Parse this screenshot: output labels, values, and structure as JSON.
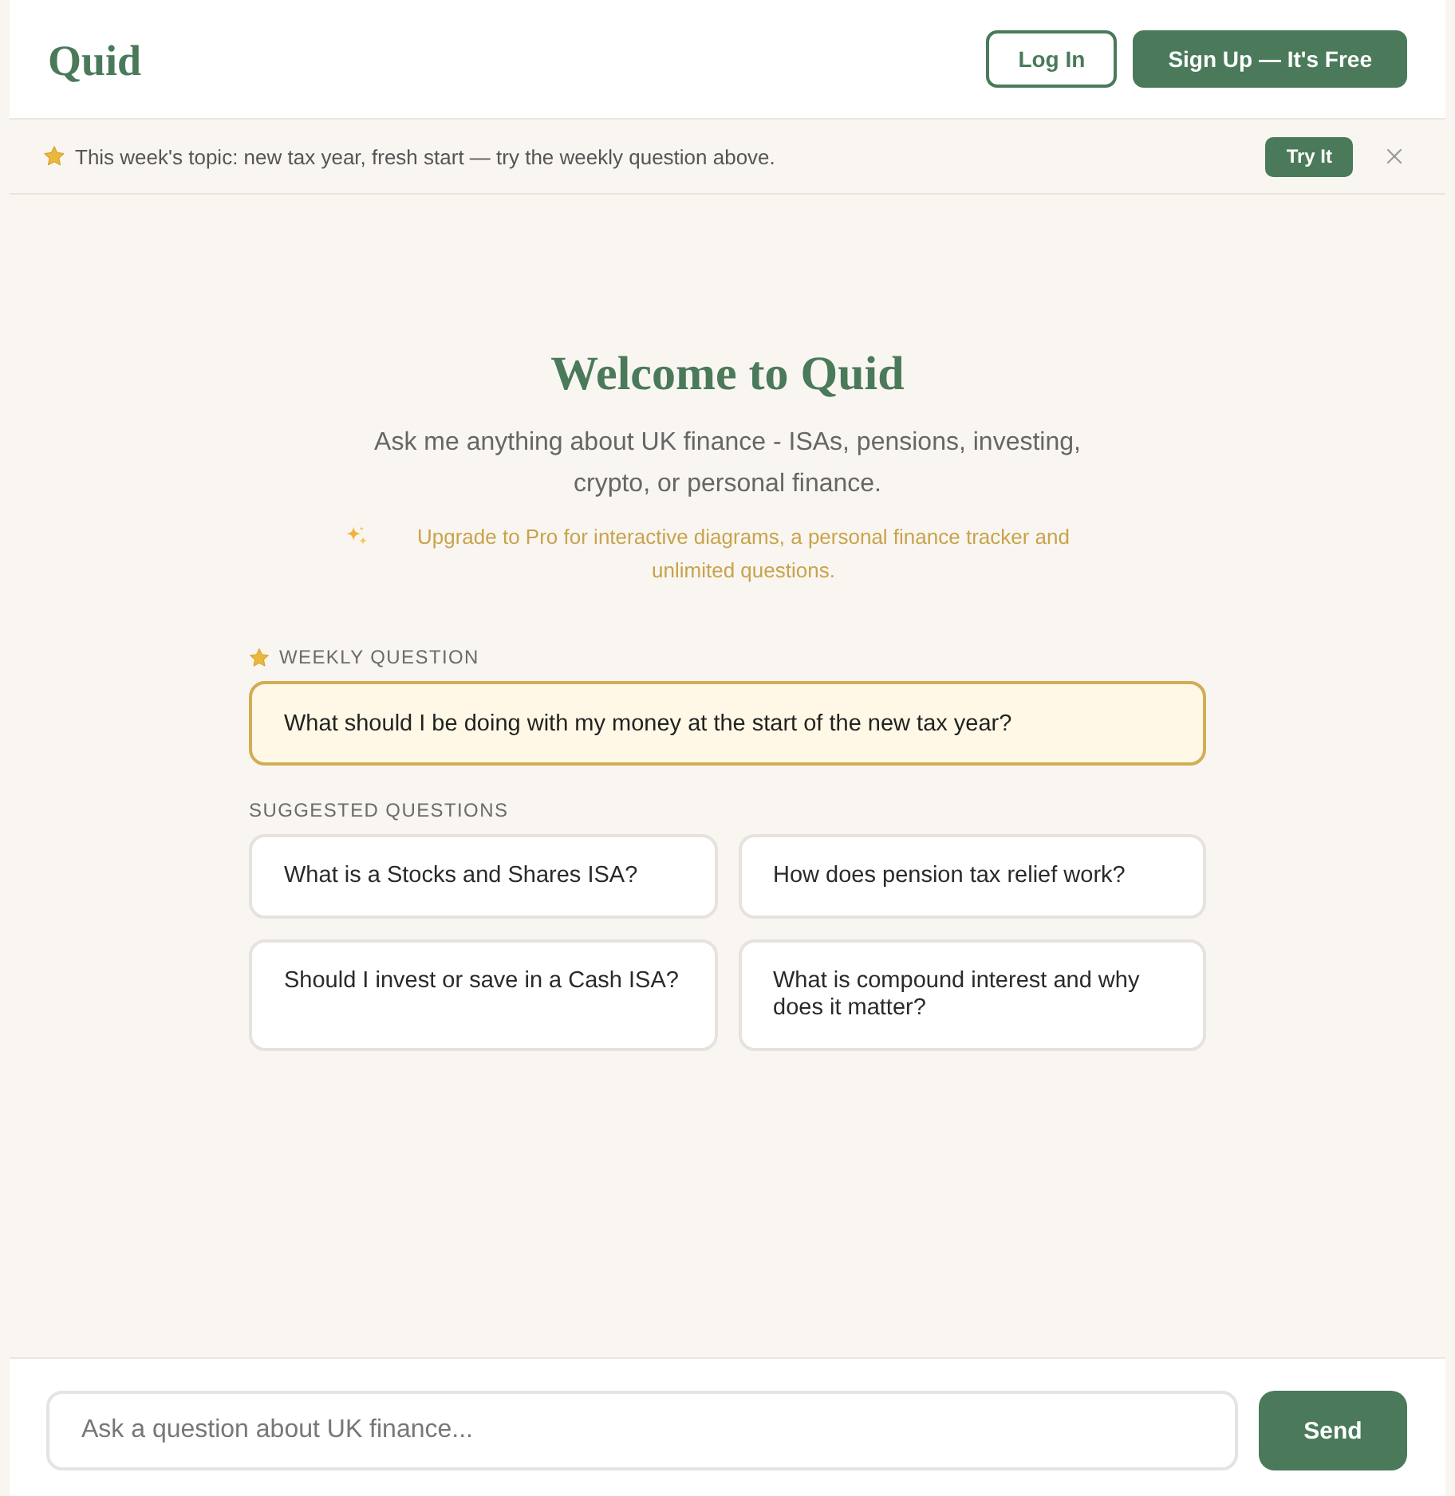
{
  "header": {
    "logo": "Quid",
    "buttons": [
      {
        "label": "Log In",
        "kind": "outline"
      },
      {
        "label": "Sign Up — It's Free",
        "kind": "primary"
      }
    ]
  },
  "banner": {
    "text": "This week's topic: new tax year, fresh start — try the weekly question above.",
    "action": "Try It"
  },
  "welcome": {
    "title": "Welcome to Quid",
    "subtitle": "Ask me anything about UK finance - ISAs, pensions, investing, crypto, or personal finance.",
    "upgrade_note": "Upgrade to Pro for interactive diagrams, a personal finance tracker and unlimited questions."
  },
  "weekly_question": {
    "label": "WEEKLY QUESTION",
    "question": "What should I be doing with my money at the start of the new tax year?"
  },
  "suggested_questions": {
    "label": "SUGGESTED QUESTIONS",
    "items": [
      "What is a Stocks and Shares ISA?",
      "How does pension tax relief work?",
      "Should I invest or save in a Cash ISA?",
      "What is compound interest and why does it matter?"
    ]
  },
  "composer": {
    "placeholder": "Ask a question about UK finance...",
    "button": "Send"
  }
}
